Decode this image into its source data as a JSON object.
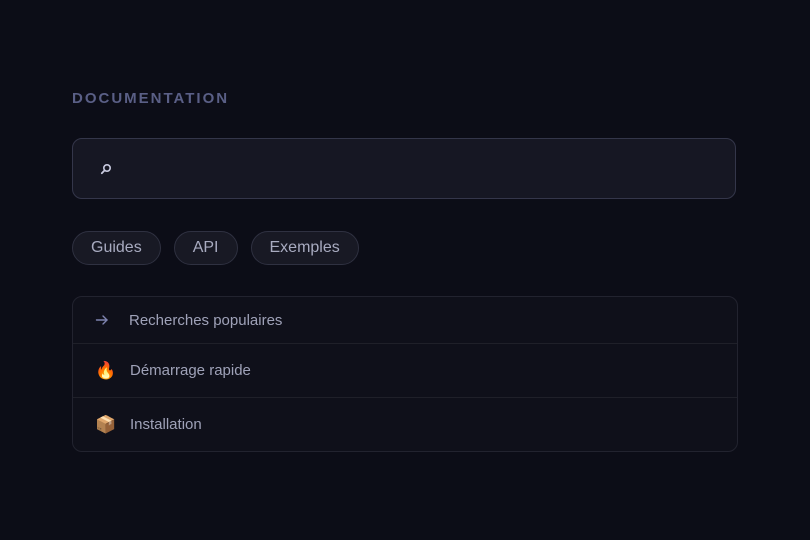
{
  "section": {
    "title": "DOCUMENTATION"
  },
  "search": {
    "value": "",
    "placeholder": ""
  },
  "chips": [
    {
      "label": "Guides"
    },
    {
      "label": "API"
    },
    {
      "label": "Exemples"
    }
  ],
  "results": {
    "header": {
      "icon": "arrow-right-icon",
      "label": "Recherches populaires"
    },
    "items": [
      {
        "icon": "fire-icon",
        "glyph": "🔥",
        "label": "Démarrage rapide"
      },
      {
        "icon": "package-icon",
        "glyph": "📦",
        "label": "Installation"
      }
    ]
  },
  "colors": {
    "background": "#0c0d17",
    "title": "#5a5f86",
    "panel": "#161723",
    "border": "#34364a",
    "text": "#9fa2b8"
  }
}
